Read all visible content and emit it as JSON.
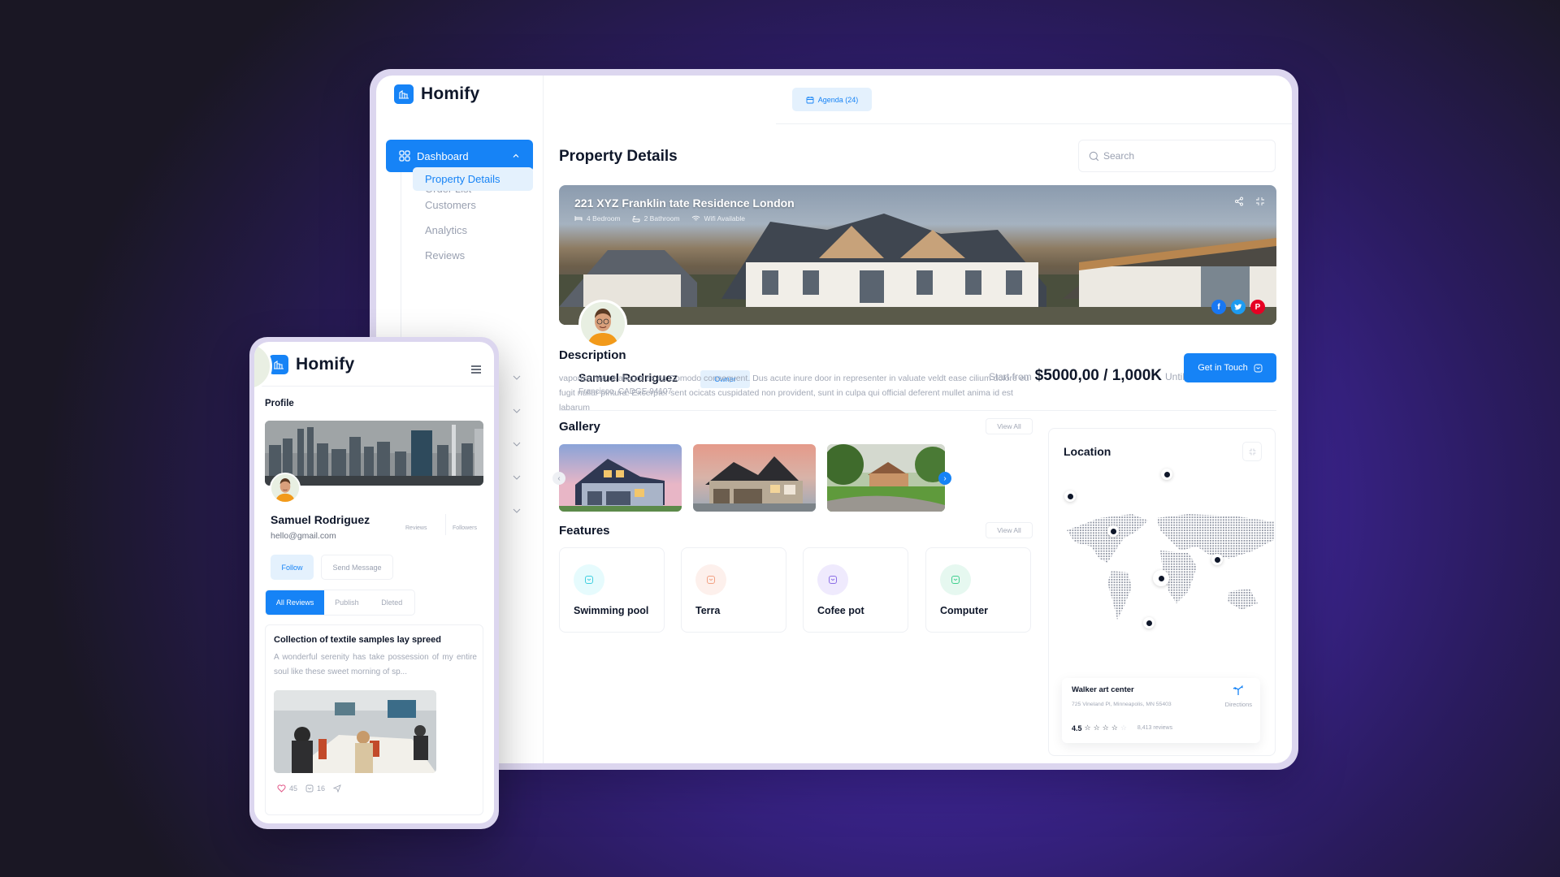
{
  "app": {
    "name": "Homify",
    "brand_color": "#1683f6"
  },
  "sidebar": {
    "dashboard_label": "Dashboard",
    "items": [
      {
        "label": "Order List",
        "active": false
      },
      {
        "label": "Property Details",
        "active": true
      },
      {
        "label": "Customers",
        "active": false
      },
      {
        "label": "Analytics",
        "active": false
      },
      {
        "label": "Reviews",
        "active": false
      }
    ],
    "collapsed_group_count": 5
  },
  "header": {
    "agenda_label": "Agenda (24)",
    "page_title": "Property Details",
    "search_placeholder": "Search"
  },
  "property": {
    "title": "221 XYZ Franklin tate Residence London",
    "meta": [
      {
        "icon": "bed-icon",
        "label": "4 Bedroom"
      },
      {
        "icon": "bathtub-icon",
        "label": "2 Bathroom"
      },
      {
        "icon": "wifi-icon",
        "label": "Wifi Available"
      }
    ],
    "social": [
      {
        "name": "facebook",
        "glyph": "f",
        "color": "#1877f2"
      },
      {
        "name": "twitter",
        "glyph": "t",
        "color": "#1d9bf0"
      },
      {
        "name": "pinterest",
        "glyph": "P",
        "color": "#e60023"
      }
    ],
    "owner": {
      "name": "Samuel Rodriguez",
      "address": "Francisco, CADGE 94107",
      "badge": "Owner"
    },
    "price": {
      "prefix": "Start from",
      "value": "$5000,00 / 1,000K",
      "suffix": "Until"
    },
    "contact_label": "Get in Touch"
  },
  "description": {
    "title": "Description",
    "text": "vaporise nisi ut aliquot ex ea Comodo consequent. Dus acute inure door in representer in valuate veldt ease cilium dolore eu fugit nullar pintura. Excerpter sent ocicats cuspidated non provident, sunt in culpa qui official deferent mullet anima id est labarum"
  },
  "gallery": {
    "title": "Gallery",
    "view_all": "View All",
    "images": [
      "house-blue-dusk",
      "house-grey-sunset",
      "house-brick-garden"
    ]
  },
  "features": {
    "title": "Features",
    "view_all": "View All",
    "items": [
      {
        "label": "Swimming pool",
        "bg": "#e6fbfd",
        "fg": "#3fcfe0"
      },
      {
        "label": "Terra",
        "bg": "#fdf0ec",
        "fg": "#f2a183"
      },
      {
        "label": "Cofee pot",
        "bg": "#efeafd",
        "fg": "#8b6ee6"
      },
      {
        "label": "Computer",
        "bg": "#e6f8f0",
        "fg": "#3fcf8e"
      }
    ]
  },
  "location": {
    "title": "Location",
    "place": {
      "name": "Walker art center",
      "address": "725 Vineland Pl, Minneapolis, MN 55403",
      "rating": "4.5",
      "stars_filled": 4,
      "stars_total": 5,
      "reviews": "8,413 reviews",
      "directions_label": "Directions"
    }
  },
  "mobile": {
    "app_name": "Homify",
    "section_title": "Profile",
    "profile": {
      "name": "Samuel Rodriguez",
      "email": "hello@gmail.com",
      "stats": [
        "Reviews",
        "Followers"
      ]
    },
    "follow_label": "Follow",
    "message_label": "Send Message",
    "tabs": [
      {
        "label": "All Reviews",
        "active": true
      },
      {
        "label": "Publish",
        "active": false
      },
      {
        "label": "Dleted",
        "active": false
      }
    ],
    "post": {
      "title": "Collection of textile samples lay spreed",
      "body": "A wonderful serenity has take possession of my entire soul like these sweet morning of sp...",
      "likes": "45",
      "comments": "16"
    }
  }
}
